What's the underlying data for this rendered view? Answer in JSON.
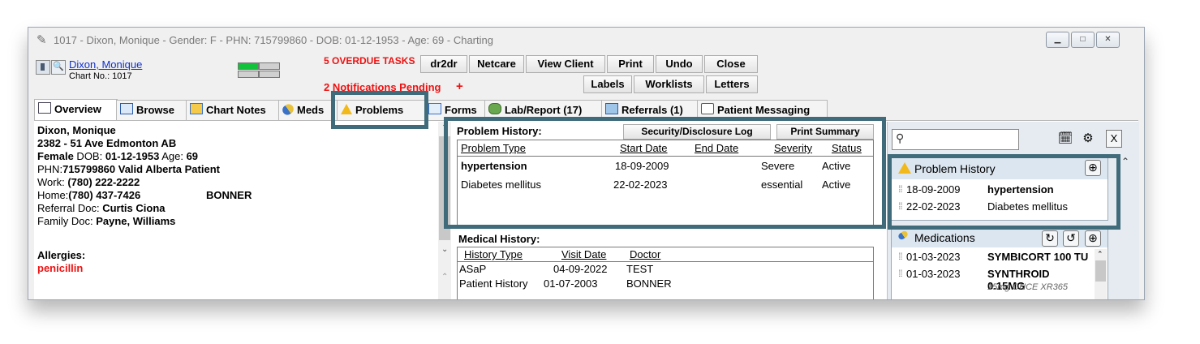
{
  "window": {
    "title": "1017 - Dixon, Monique - Gender: F - PHN: 715799860 - DOB: 01-12-1953 - Age: 69 - Charting",
    "controls": [
      "minimize",
      "maximize",
      "close"
    ]
  },
  "patient_header": {
    "name_link": "Dixon, Monique",
    "chart_no": "Chart No.: 1017",
    "overdue_tasks": "5 OVERDUE TASKS",
    "notifications": "2 Notifications Pending",
    "notifications_add": "+"
  },
  "toolbar": {
    "row1": [
      "dr2dr",
      "Netcare",
      "View Client",
      "Print",
      "Undo",
      "Close"
    ],
    "row2": [
      "Labels",
      "Worklists",
      "Letters"
    ]
  },
  "tabs": [
    {
      "label": "Overview",
      "icon": "overview-icon"
    },
    {
      "label": "Browse",
      "icon": "browse-icon"
    },
    {
      "label": "Chart Notes",
      "icon": "chart-notes-icon"
    },
    {
      "label": "Meds",
      "icon": "pill-icon"
    },
    {
      "label": "Problems",
      "icon": "warning-icon"
    },
    {
      "label": "Forms",
      "icon": "forms-icon"
    },
    {
      "label": "Lab/Report (17)",
      "icon": "lab-icon"
    },
    {
      "label": "Referrals (1)",
      "icon": "referrals-icon"
    },
    {
      "label": "Patient Messaging",
      "icon": "messaging-icon"
    }
  ],
  "demographics": {
    "name": "Dixon, Monique",
    "address": "2382 - 51 Ave Edmonton  AB",
    "sex": "Female",
    "dob_label": " DOB: ",
    "dob": "01-12-1953",
    "age_label": " Age: ",
    "age": "69",
    "phn_label": "PHN:",
    "phn": "715799860 Valid Alberta Patient",
    "work_label": "Work: ",
    "work": "(780) 222-2222",
    "home_label": "Home:",
    "home": "(780) 437-7426",
    "home_extra": "BONNER",
    "referral_label": "Referral Doc:  ",
    "referral": "Curtis Ciona",
    "family_label": "Family Doc: ",
    "family": "Payne, Williams",
    "allergies_label": "Allergies:",
    "allergy": "penicillin"
  },
  "problem_history": {
    "title": "Problem History:",
    "security_button": "Security/Disclosure Log",
    "print_button": "Print Summary",
    "columns": [
      "Problem Type",
      "Start Date",
      "End Date",
      "Severity",
      "Status"
    ],
    "rows": [
      {
        "type": "hypertension",
        "start": "18-09-2009",
        "end": "",
        "severity": "Severe",
        "status": "Active"
      },
      {
        "type": "Diabetes mellitus",
        "start": "22-02-2023",
        "end": "",
        "severity": "essential",
        "status": "Active"
      }
    ]
  },
  "medical_history": {
    "title": "Medical History:",
    "columns": [
      "History Type",
      "Visit Date",
      "Doctor"
    ],
    "rows": [
      {
        "type": "ASaP",
        "date": "04-09-2022",
        "doctor": "TEST"
      },
      {
        "type": "Patient History",
        "date": "01-07-2003",
        "doctor": "BONNER"
      }
    ]
  },
  "side_panel": {
    "search_placeholder": "",
    "problem_card": {
      "title": "Problem History",
      "items": [
        {
          "date": "18-09-2009",
          "name": "hypertension"
        },
        {
          "date": "22-02-2023",
          "name": "Diabetes mellitus"
        }
      ]
    },
    "medications_card": {
      "title": "Medications",
      "items": [
        {
          "date": "01-03-2023",
          "name": "SYMBICORT 100 TU"
        },
        {
          "date": "01-03-2023",
          "name": "SYNTHROID 0.15MG"
        }
      ],
      "partial_line": "15mg ONCE XR365"
    }
  },
  "colors": {
    "highlight_border": "#3f6b7a",
    "alert_red": "#ee1111",
    "card_header": "#dce6f0"
  }
}
